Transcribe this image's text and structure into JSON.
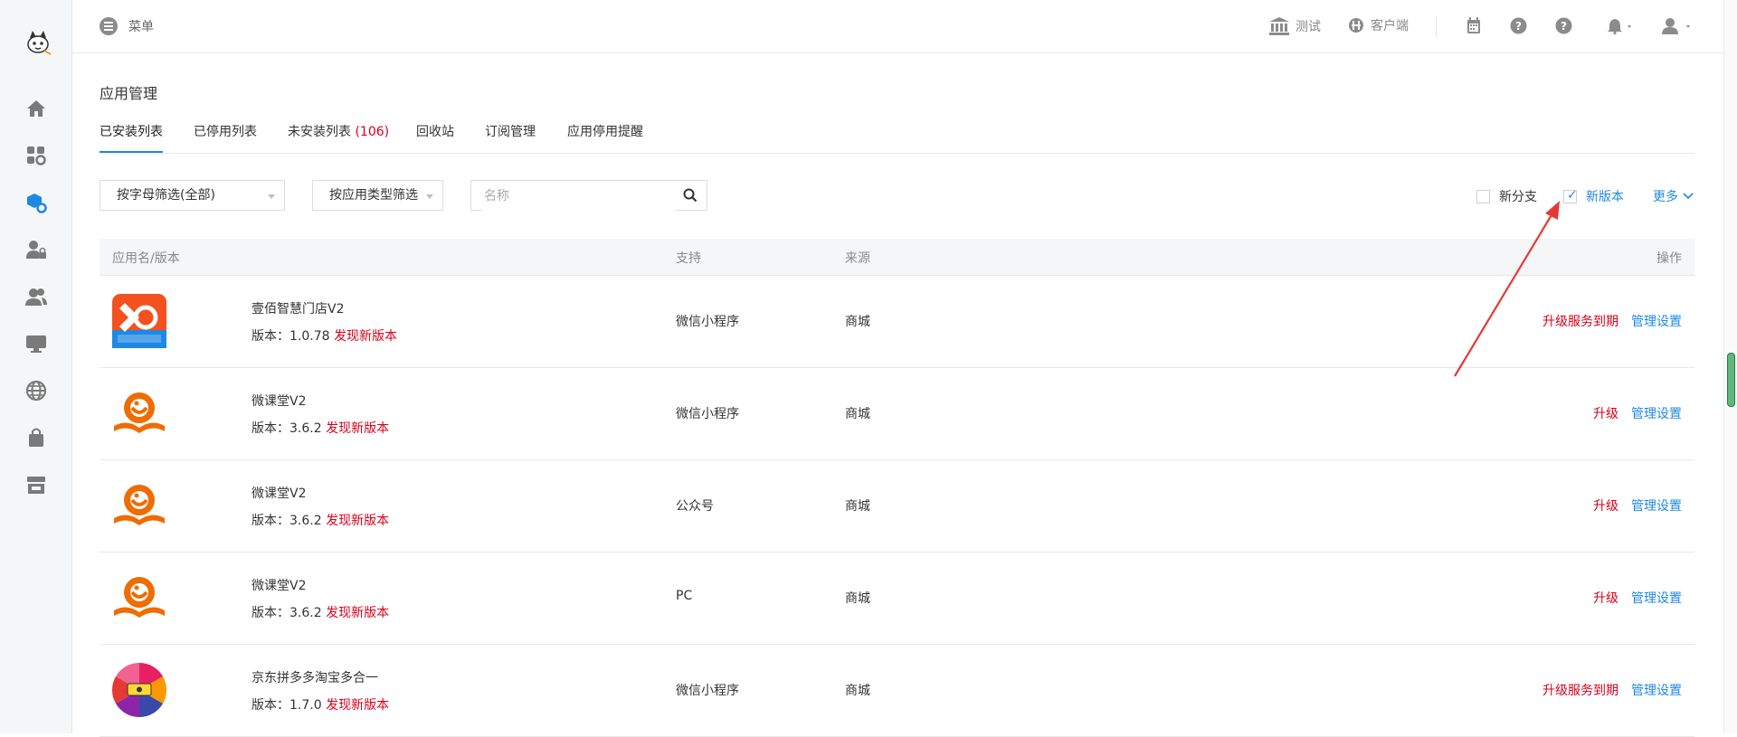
{
  "header": {
    "menu_label": "菜单",
    "env_label": "测试",
    "client_label": "客户端"
  },
  "page": {
    "title": "应用管理"
  },
  "tabs": [
    {
      "label": "已安装列表"
    },
    {
      "label": "已停用列表"
    },
    {
      "label": "未安装列表",
      "count": "(106)"
    },
    {
      "label": "回收站"
    },
    {
      "label": "订阅管理"
    },
    {
      "label": "应用停用提醒"
    }
  ],
  "filters": {
    "letter_filter": "按字母筛选(全部)",
    "type_filter": "按应用类型筛选",
    "search_placeholder": "名称",
    "new_branch_label": "新分支",
    "new_branch_checked": false,
    "new_version_label": "新版本",
    "new_version_checked": true,
    "more_label": "更多"
  },
  "table": {
    "headers": {
      "name": "应用名/版本",
      "support": "支持",
      "source": "来源",
      "actions": "操作"
    },
    "version_prefix": "版本：",
    "rows": [
      {
        "name": "壹佰智慧门店V2",
        "version": "1.0.78",
        "new_version": "发现新版本",
        "support": "微信小程序",
        "source": "商城",
        "action_red": "升级服务到期",
        "action_blue": "管理设置",
        "icon": "smart-store-icon"
      },
      {
        "name": "微课堂V2",
        "version": "3.6.2",
        "new_version": "发现新版本",
        "support": "微信小程序",
        "source": "商城",
        "action_red": "升级",
        "action_blue": "管理设置",
        "icon": "micro-class-icon"
      },
      {
        "name": "微课堂V2",
        "version": "3.6.2",
        "new_version": "发现新版本",
        "support": "公众号",
        "source": "商城",
        "action_red": "升级",
        "action_blue": "管理设置",
        "icon": "micro-class-icon"
      },
      {
        "name": "微课堂V2",
        "version": "3.6.2",
        "new_version": "发现新版本",
        "support": "PC",
        "source": "商城",
        "action_red": "升级",
        "action_blue": "管理设置",
        "icon": "micro-class-icon"
      },
      {
        "name": "京东拼多多淘宝多合一",
        "version": "1.7.0",
        "new_version": "发现新版本",
        "support": "微信小程序",
        "source": "商城",
        "action_red": "升级服务到期",
        "action_blue": "管理设置",
        "icon": "multi-mall-icon"
      }
    ]
  },
  "colors": {
    "accent": "#1e88e5",
    "danger": "#d9001b",
    "annotation": "#e53935"
  }
}
